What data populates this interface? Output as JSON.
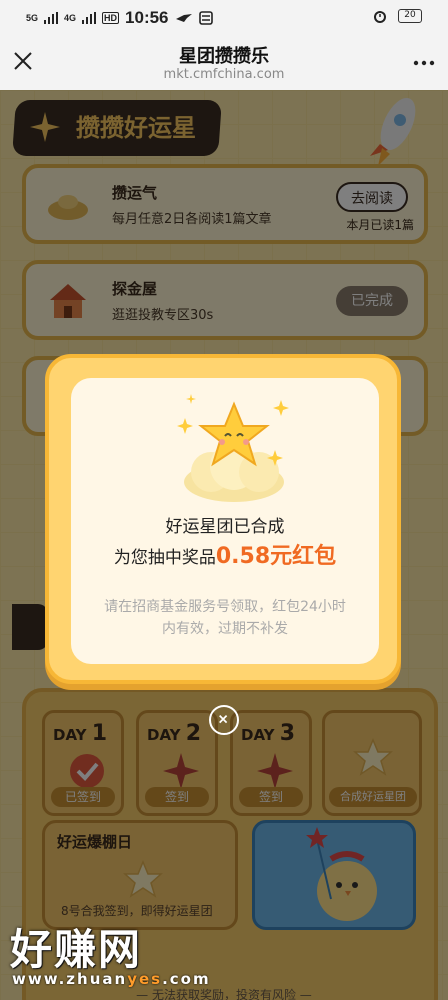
{
  "status_bar": {
    "signal_1": "5G",
    "signal_2": "4G",
    "hd": "HD",
    "time": "10:56",
    "battery": "20"
  },
  "nav": {
    "title": "星团攒攒乐",
    "subtitle": "mkt.cmfchina.com"
  },
  "banner": {
    "title": "攒攒好运星"
  },
  "tasks": [
    {
      "title": "攒运气",
      "desc": "每月任意2日各阅读1篇文章",
      "button": "去阅读",
      "progress": "本月已读1篇"
    },
    {
      "title": "探金屋",
      "desc": "逛逛投教专区30s",
      "button": "已完成"
    }
  ],
  "checkin": {
    "days": [
      {
        "prefix": "DAY",
        "num": "1",
        "button": "已签到"
      },
      {
        "prefix": "DAY",
        "num": "2",
        "button": "签到"
      },
      {
        "prefix": "DAY",
        "num": "3",
        "button": "签到"
      }
    ],
    "merge_button": "合成好运星团",
    "lucky_title": "好运爆棚日",
    "lucky_sub": "8号合我签到，即得好运星团",
    "bottom_hint": "— 无法获取奖励，投资有风险 —"
  },
  "modal": {
    "line1": "好运星团已合成",
    "line2_prefix": "为您抽中奖品",
    "prize": "0.58元红包",
    "note": "请在招商基金服务号领取，红包24小时内有效，过期不补发"
  },
  "watermark": {
    "text": "好赚网",
    "url_prefix": "www.zhuan",
    "url_highlight": "yes",
    "url_suffix": ".com"
  },
  "colors": {
    "accent": "#f06a22",
    "page_bg": "#fbe7a6",
    "modal_bg": "#ffd470",
    "dark": "#3b2d22"
  }
}
